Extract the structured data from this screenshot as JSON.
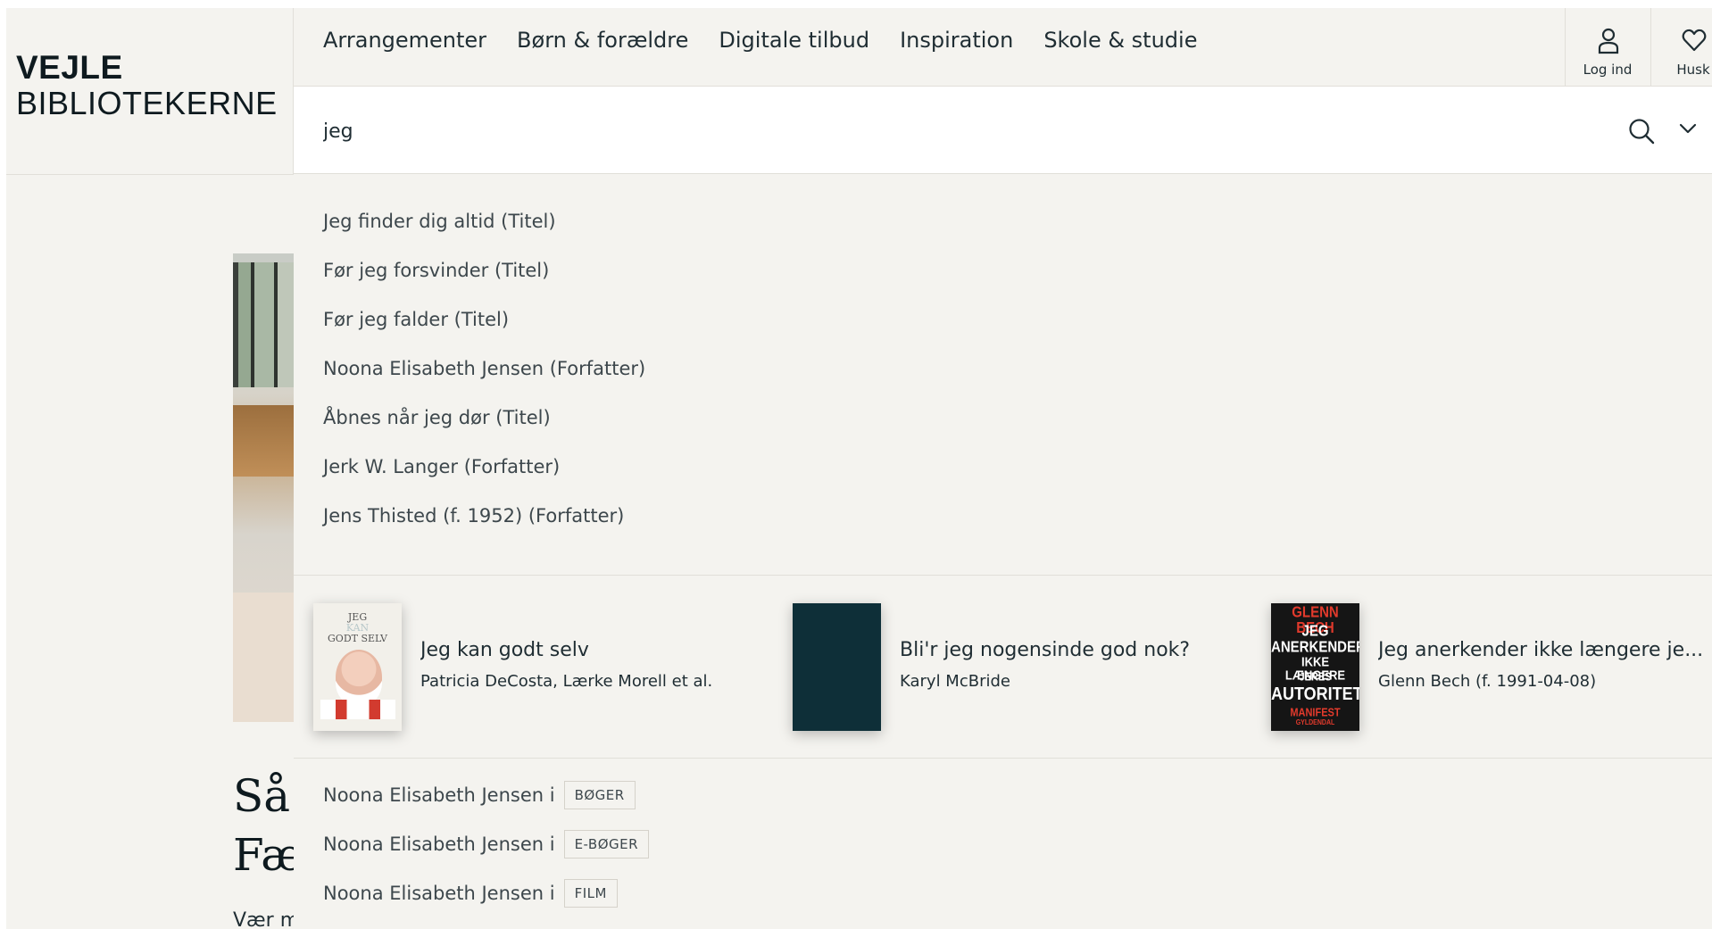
{
  "logo": {
    "line1": "VEJLE",
    "line2": "BIBLIOTEKERNE"
  },
  "nav": {
    "items": [
      "Arrangementer",
      "Børn & forældre",
      "Digitale tilbud",
      "Inspiration",
      "Skole & studie"
    ]
  },
  "header_actions": {
    "login_label": "Log ind",
    "remember_label": "Husk"
  },
  "search": {
    "value": "jeg"
  },
  "suggestions": [
    "Jeg finder dig altid (Titel)",
    "Før jeg forsvinder (Titel)",
    "Før jeg falder (Titel)",
    "Noona Elisabeth Jensen (Forfatter)",
    "Åbnes når jeg dør (Titel)",
    "Jerk W. Langer (Forfatter)",
    "Jens Thisted (f. 1952) (Forfatter)"
  ],
  "works": [
    {
      "title": "Jeg kan godt selv",
      "author": "Patricia DeCosta, Lærke Morell et al.",
      "cover_text": [
        "JEG",
        "KAN",
        "GODT SELV"
      ]
    },
    {
      "title": "Bli'r jeg nogensinde god nok?",
      "author": "Karyl McBride"
    },
    {
      "title": "Jeg anerkender ikke længere je...",
      "author": "Glenn Bech (f. 1991-04-08)",
      "cover_text": [
        "GLENN BECH",
        "JEG",
        "ANERKENDER",
        "IKKE LÆNGERE",
        "JERES",
        "AUTORITET",
        "MANIFEST",
        "GYLDENDAL"
      ]
    }
  ],
  "format_suggestions": [
    {
      "text": "Noona Elisabeth Jensen i",
      "tag": "BØGER"
    },
    {
      "text": "Noona Elisabeth Jensen i",
      "tag": "E-BØGER"
    },
    {
      "text": "Noona Elisabeth Jensen i",
      "tag": "FILM"
    }
  ],
  "background_article": {
    "heading_line1": "Så",
    "heading_line2": "Fæ",
    "text": "Vær m"
  },
  "colors": {
    "page_bg": "#f4f3ef",
    "divider": "#e1dfd9",
    "text": "#1f2d33",
    "cover_dark": "#0e2f38",
    "accent_red": "#d23b2f"
  },
  "icons": [
    "user-icon",
    "heart-icon",
    "search-icon",
    "chevron-down-icon"
  ]
}
